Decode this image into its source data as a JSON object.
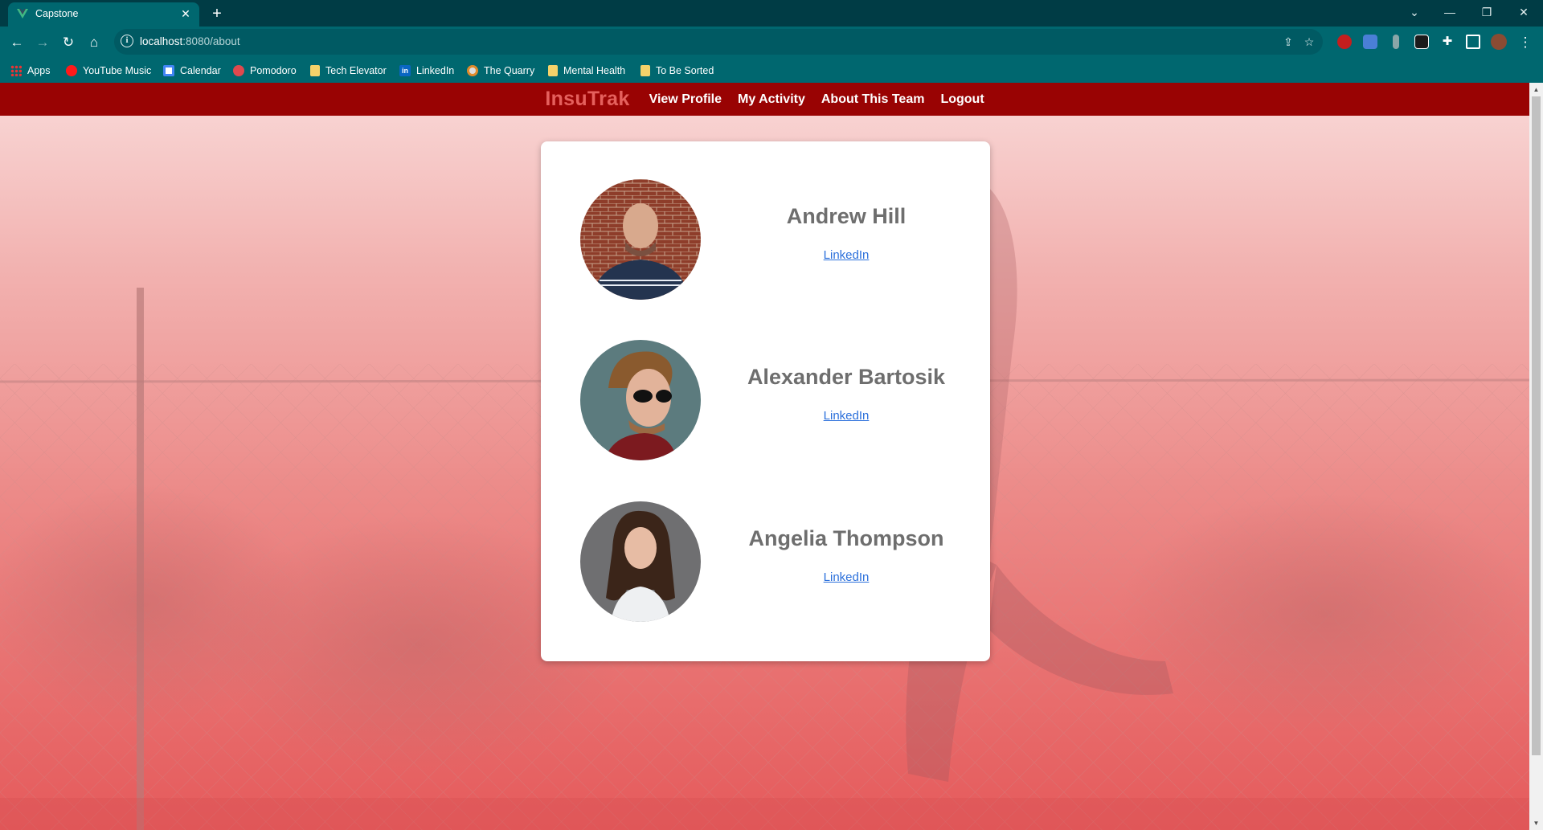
{
  "browser": {
    "tab_title": "Capstone",
    "url_host": "localhost",
    "url_path": ":8080/about",
    "bookmarks": [
      {
        "label": "Apps",
        "icon": "apps-grid-icon"
      },
      {
        "label": "YouTube Music",
        "icon": "youtube-music-icon"
      },
      {
        "label": "Calendar",
        "icon": "calendar-icon"
      },
      {
        "label": "Pomodoro",
        "icon": "pomodoro-icon"
      },
      {
        "label": "Tech Elevator",
        "icon": "folder-icon"
      },
      {
        "label": "LinkedIn",
        "icon": "linkedin-icon"
      },
      {
        "label": "The Quarry",
        "icon": "quarry-icon"
      },
      {
        "label": "Mental Health",
        "icon": "folder-icon"
      },
      {
        "label": "To Be Sorted",
        "icon": "folder-icon"
      }
    ]
  },
  "app": {
    "brand": "InsuTrak",
    "nav": [
      "View Profile",
      "My Activity",
      "About This Team",
      "Logout"
    ],
    "brand_color": "#e5605d",
    "nav_bg": "#990303"
  },
  "team": [
    {
      "name": "Andrew Hill",
      "link": "LinkedIn"
    },
    {
      "name": "Alexander Bartosik",
      "link": "LinkedIn"
    },
    {
      "name": "Angelia Thompson",
      "link": "LinkedIn"
    }
  ]
}
